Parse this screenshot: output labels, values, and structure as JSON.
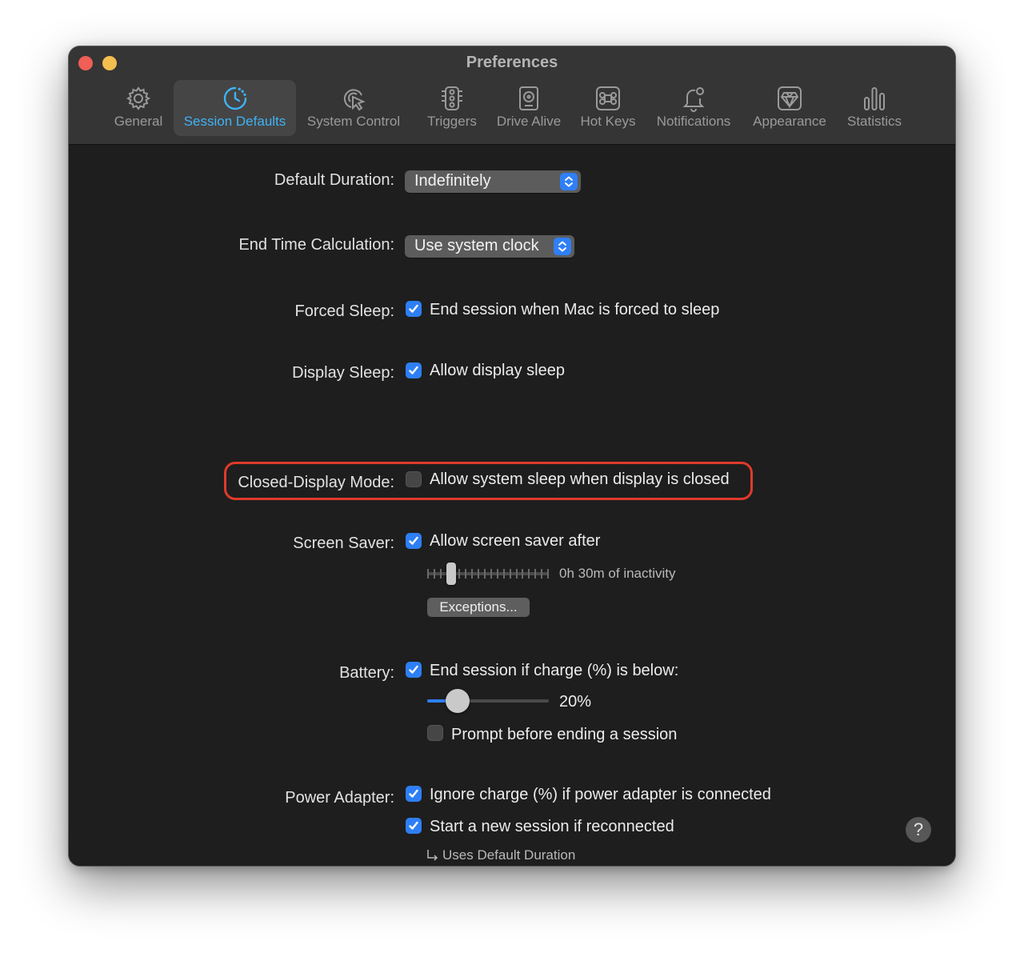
{
  "window": {
    "title": "Preferences"
  },
  "tabs": [
    {
      "label": "General",
      "icon": "gear-icon"
    },
    {
      "label": "Session Defaults",
      "icon": "clock-icon",
      "selected": true
    },
    {
      "label": "System Control",
      "icon": "cursor-click-icon"
    },
    {
      "label": "Triggers",
      "icon": "triggers-icon"
    },
    {
      "label": "Drive Alive",
      "icon": "drive-icon"
    },
    {
      "label": "Hot Keys",
      "icon": "command-key-icon"
    },
    {
      "label": "Notifications",
      "icon": "bell-icon"
    },
    {
      "label": "Appearance",
      "icon": "gem-icon"
    },
    {
      "label": "Statistics",
      "icon": "bar-chart-icon"
    }
  ],
  "settings": {
    "default_duration": {
      "label": "Default Duration:",
      "value": "Indefinitely"
    },
    "end_time_calc": {
      "label": "End Time Calculation:",
      "value": "Use system clock"
    },
    "forced_sleep": {
      "label": "Forced Sleep:",
      "option": "End session when Mac is forced to sleep",
      "checked": true
    },
    "display_sleep": {
      "label": "Display Sleep:",
      "option": "Allow display sleep",
      "checked": true
    },
    "closed_display": {
      "label": "Closed-Display Mode:",
      "option": "Allow system sleep when display is closed",
      "checked": false
    },
    "screen_saver": {
      "label": "Screen Saver:",
      "option": "Allow screen saver after",
      "checked": true,
      "slider_text": "0h 30m of inactivity",
      "slider_fraction": 0.2,
      "button": "Exceptions..."
    },
    "battery": {
      "label": "Battery:",
      "option": "End session if charge (%) is below:",
      "checked": true,
      "value": "20%",
      "slider_fraction": 0.25,
      "prompt_option": "Prompt before ending a session",
      "prompt_checked": false
    },
    "power_adapter": {
      "label": "Power Adapter:",
      "option1": "Ignore charge (%) if power adapter is connected",
      "option1_checked": true,
      "option2": "Start a new session if reconnected",
      "option2_checked": true,
      "note": "Uses Default Duration"
    }
  },
  "help": {
    "label": "?"
  },
  "colors": {
    "accent": "#2e7ff5",
    "selected_tab": "#3fb3f5",
    "highlight": "#e03a2a"
  }
}
